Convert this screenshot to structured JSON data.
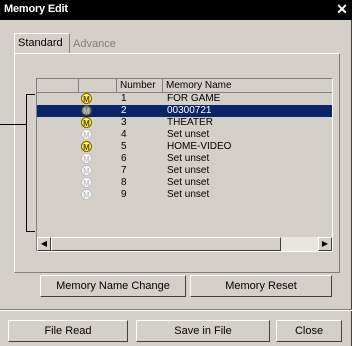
{
  "window": {
    "title": "Memory Edit",
    "close_label": "✕"
  },
  "tabs": [
    {
      "label": "Standard",
      "active": true
    },
    {
      "label": "Advance",
      "active": false
    }
  ],
  "list": {
    "columns": [
      "",
      "Number",
      "Memory Name"
    ],
    "rows": [
      {
        "icon": "on",
        "number": "1",
        "name": "FOR  GAME",
        "selected": false
      },
      {
        "icon": "sel",
        "number": "2",
        "name": "00300721",
        "selected": true
      },
      {
        "icon": "on",
        "number": "3",
        "name": "THEATER",
        "selected": false
      },
      {
        "icon": "off",
        "number": "4",
        "name": "Set unset",
        "selected": false
      },
      {
        "icon": "on",
        "number": "5",
        "name": "HOME-VIDEO",
        "selected": false
      },
      {
        "icon": "off",
        "number": "6",
        "name": "Set unset",
        "selected": false
      },
      {
        "icon": "off",
        "number": "7",
        "name": "Set unset",
        "selected": false
      },
      {
        "icon": "off",
        "number": "8",
        "name": "Set unset",
        "selected": false
      },
      {
        "icon": "off",
        "number": "9",
        "name": "Set unset",
        "selected": false
      }
    ],
    "icon_letter": "M"
  },
  "buttons": {
    "memory_name_change": "Memory Name Change",
    "memory_reset": "Memory Reset",
    "file_read": "File Read",
    "save_in_file": "Save in File",
    "close": "Close"
  },
  "scroll": {
    "left_arrow": "◀",
    "right_arrow": "▶"
  }
}
